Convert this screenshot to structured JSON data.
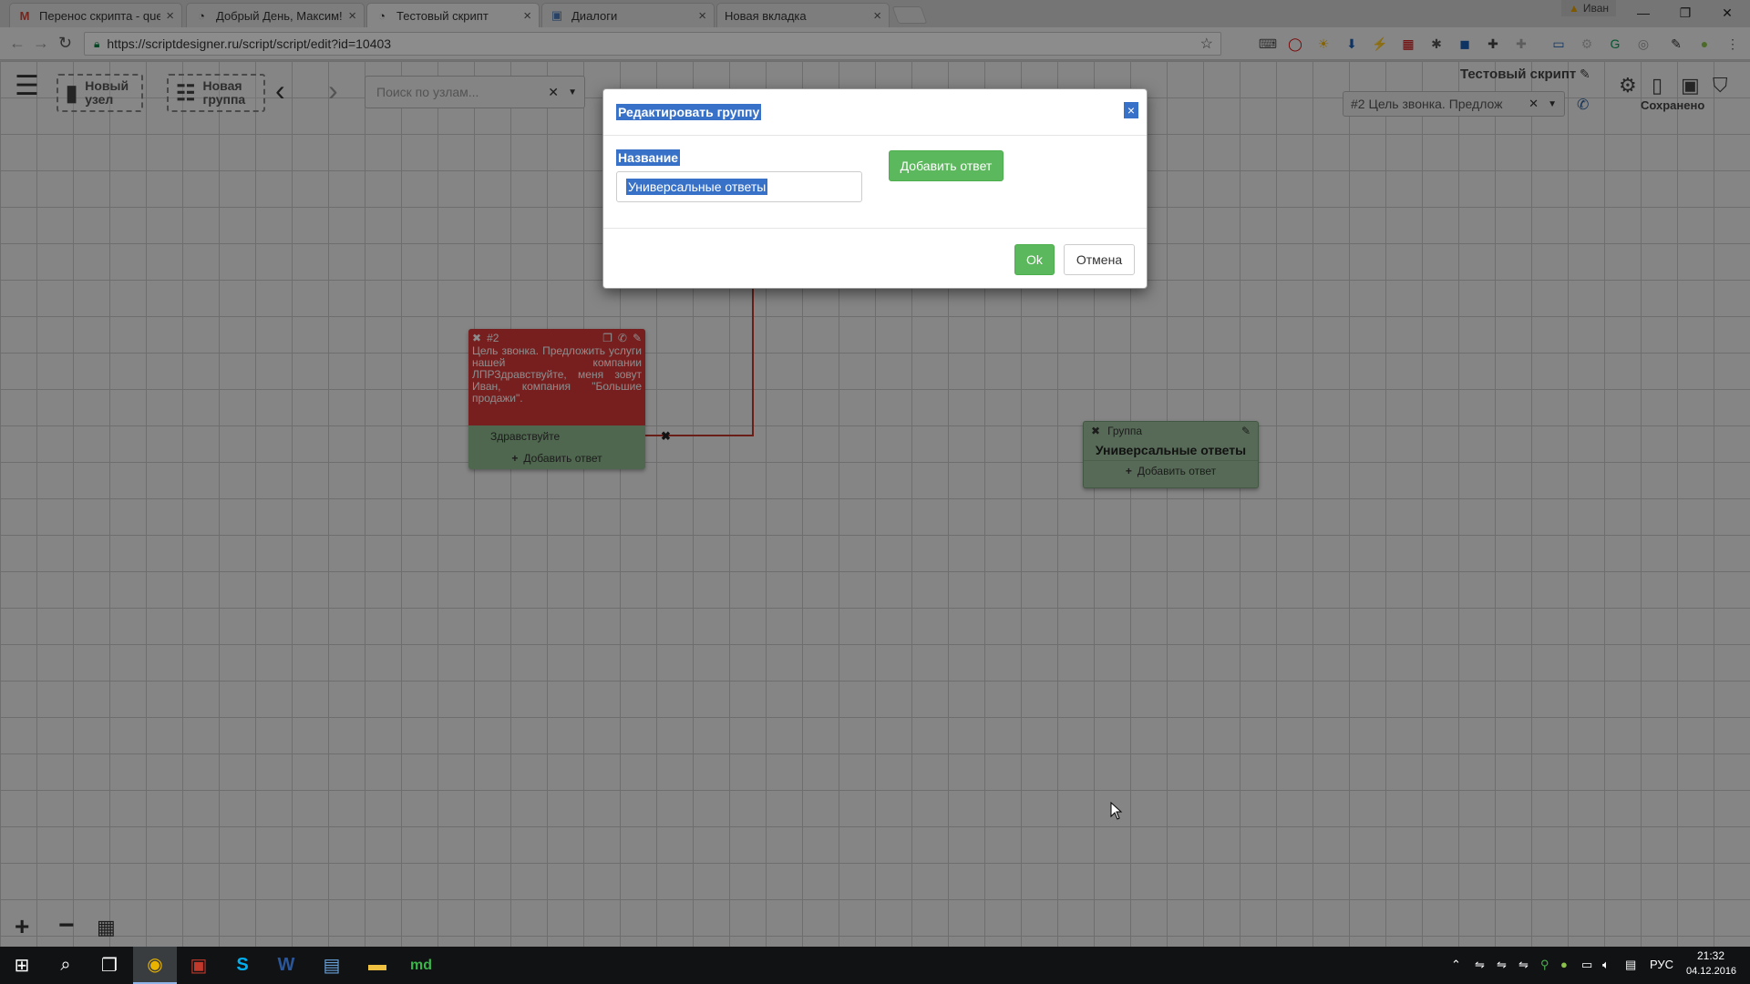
{
  "browser": {
    "tabs": [
      {
        "label": "Перенос скрипта - quel",
        "icon": "gmail-icon"
      },
      {
        "label": "Добрый День, Максим!",
        "icon": "scriptdesigner-icon"
      },
      {
        "label": "Тестовый скрипт",
        "icon": "scriptdesigner-icon"
      },
      {
        "label": "Диалоги",
        "icon": "chat-icon"
      },
      {
        "label": "Новая вкладка",
        "icon": ""
      }
    ],
    "profile_name": "Иван",
    "url": "https://scriptdesigner.ru/script/script/edit?id=10403"
  },
  "app": {
    "new_node_label": "Новый узел",
    "new_group_label": "Новая группа",
    "search_placeholder": "Поиск по узлам...",
    "script_title": "Тестовый скрипт",
    "node_select_value": "#2 Цель звонка. Предлож",
    "save_status": "Сохранено"
  },
  "nodes": {
    "node2": {
      "id": "#2",
      "text": "Цель звонка. Предложить услуги нашей компании ЛПРЗдравствуйте, меня зовут Иван, компания \"Большие продажи\".",
      "answer": "Здравствуйте",
      "add_answer": "Добавить ответ",
      "color": "#d93a3a"
    },
    "group": {
      "type_label": "Группа",
      "name": "Универсальные ответы",
      "add_answer": "Добавить ответ",
      "color": "#8fbc8f"
    }
  },
  "modal": {
    "title": "Редактировать группу",
    "name_label": "Название",
    "name_value": "Универсальные ответы",
    "add_answer_button": "Добавить ответ",
    "ok_button": "Ok",
    "cancel_button": "Отмена"
  },
  "taskbar": {
    "language": "РУС",
    "time": "21:32",
    "date": "04.12.2016"
  }
}
